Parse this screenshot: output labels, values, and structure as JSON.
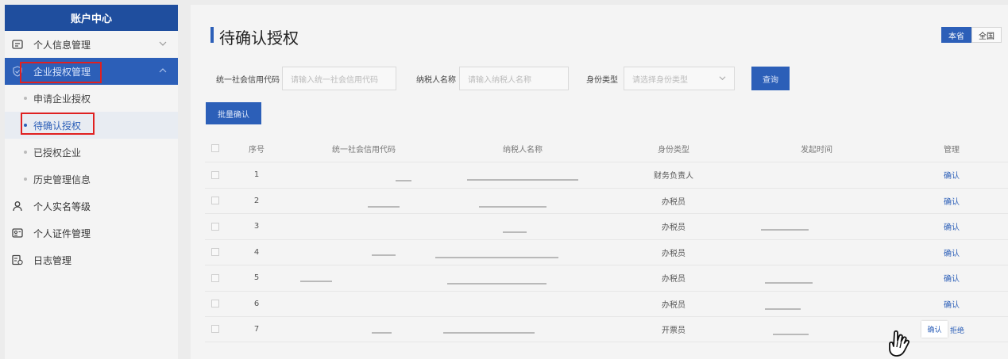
{
  "sidebar": {
    "title": "账户中心",
    "items": [
      {
        "label": "个人信息管理"
      },
      {
        "label": "企业授权管理"
      },
      {
        "label": "申请企业授权"
      },
      {
        "label": "待确认授权"
      },
      {
        "label": "已授权企业"
      },
      {
        "label": "历史管理信息"
      },
      {
        "label": "个人实名等级"
      },
      {
        "label": "个人证件管理"
      },
      {
        "label": "日志管理"
      }
    ]
  },
  "main": {
    "title": "待确认授权",
    "scope": [
      "本省",
      "全国"
    ],
    "filters": {
      "credit_code_label": "统一社会信用代码",
      "credit_code_placeholder": "请输入统一社会信用代码",
      "taxpayer_label": "纳税人名称",
      "taxpayer_placeholder": "请输入纳税人名称",
      "identity_label": "身份类型",
      "identity_placeholder": "请选择身份类型",
      "query_button": "查询"
    },
    "batch_button": "批量确认",
    "table": {
      "headers": [
        "序号",
        "统一社会信用代码",
        "纳税人名称",
        "身份类型",
        "发起时间",
        "管理"
      ],
      "rows": [
        {
          "index": "1",
          "identity": "财务负责人",
          "action": "确认"
        },
        {
          "index": "2",
          "identity": "办税员",
          "action": "确认"
        },
        {
          "index": "3",
          "identity": "办税员",
          "action": "确认"
        },
        {
          "index": "4",
          "identity": "办税员",
          "action": "确认"
        },
        {
          "index": "5",
          "identity": "办税员",
          "action": "确认"
        },
        {
          "index": "6",
          "identity": "办税员",
          "action": "确认"
        },
        {
          "index": "7",
          "identity": "开票员",
          "action": "确认",
          "action2": "拒绝"
        }
      ]
    }
  },
  "colors": {
    "brand": "#2c5fb8",
    "highlight": "#e02020"
  }
}
